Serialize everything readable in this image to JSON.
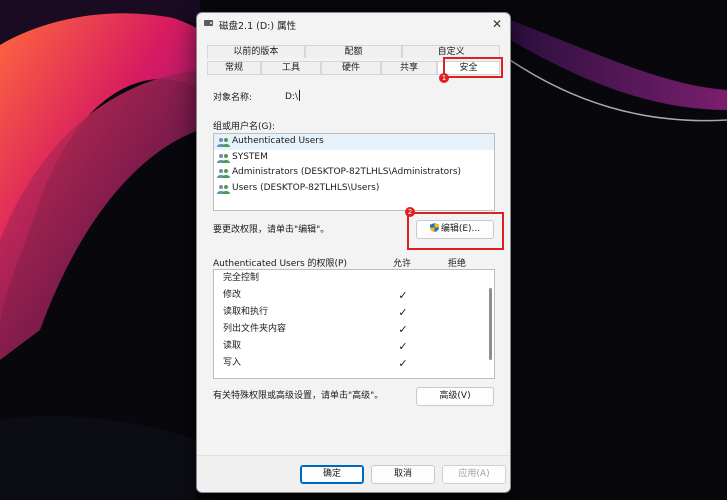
{
  "window": {
    "title": "磁盘2.1 (D:) 属性",
    "close_glyph": "✕"
  },
  "tabs": {
    "top_row": [
      "以前的版本",
      "配额",
      "自定义"
    ],
    "bottom_row": [
      "常规",
      "工具",
      "硬件",
      "共享",
      "安全"
    ],
    "active": "安全"
  },
  "badges": {
    "first": "1",
    "second": "2"
  },
  "security": {
    "object_name_label": "对象名称:",
    "object_name_value": "D:\\",
    "group_label": "组或用户名(G):",
    "users": [
      "Authenticated Users",
      "SYSTEM",
      "Administrators (DESKTOP-82TLHLS\\Administrators)",
      "Users (DESKTOP-82TLHLS\\Users)"
    ],
    "change_hint": "要更改权限，请单击\"编辑\"。",
    "edit_button": "编辑(E)...",
    "permissions_label": "Authenticated Users 的权限(P)",
    "allow_header": "允许",
    "deny_header": "拒绝",
    "permissions": [
      {
        "name": "完全控制",
        "allow": "",
        "deny": ""
      },
      {
        "name": "修改",
        "allow": "✓",
        "deny": ""
      },
      {
        "name": "读取和执行",
        "allow": "✓",
        "deny": ""
      },
      {
        "name": "列出文件夹内容",
        "allow": "✓",
        "deny": ""
      },
      {
        "name": "读取",
        "allow": "✓",
        "deny": ""
      },
      {
        "name": "写入",
        "allow": "✓",
        "deny": ""
      }
    ],
    "advanced_hint": "有关特殊权限或高级设置，请单击\"高级\"。",
    "advanced_button": "高级(V)"
  },
  "footer": {
    "ok": "确定",
    "cancel": "取消",
    "apply": "应用(A)"
  },
  "colors": {
    "annotation_red": "#e02020",
    "accent_blue": "#0067c0",
    "selection": "#e5f1fb"
  },
  "icons": [
    "close-icon",
    "user-group-icon",
    "uac-shield-icon",
    "checkmark-icon",
    "drive-icon"
  ]
}
